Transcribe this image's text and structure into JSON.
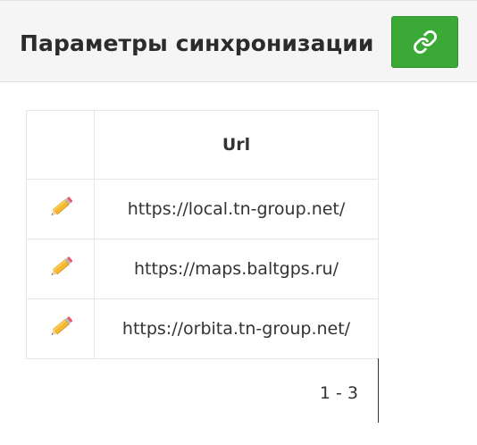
{
  "header": {
    "title": "Параметры синхронизации",
    "link_button_icon": "link-icon",
    "link_button_color": "#3aa935"
  },
  "table": {
    "columns": [
      "",
      "Url"
    ],
    "rows": [
      {
        "edit_icon": "pencil-icon",
        "url": "https://local.tn-group.net/"
      },
      {
        "edit_icon": "pencil-icon",
        "url": "https://maps.baltgps.ru/"
      },
      {
        "edit_icon": "pencil-icon",
        "url": "https://orbita.tn-group.net/"
      }
    ]
  },
  "pager": {
    "range_label": "1 - 3"
  }
}
